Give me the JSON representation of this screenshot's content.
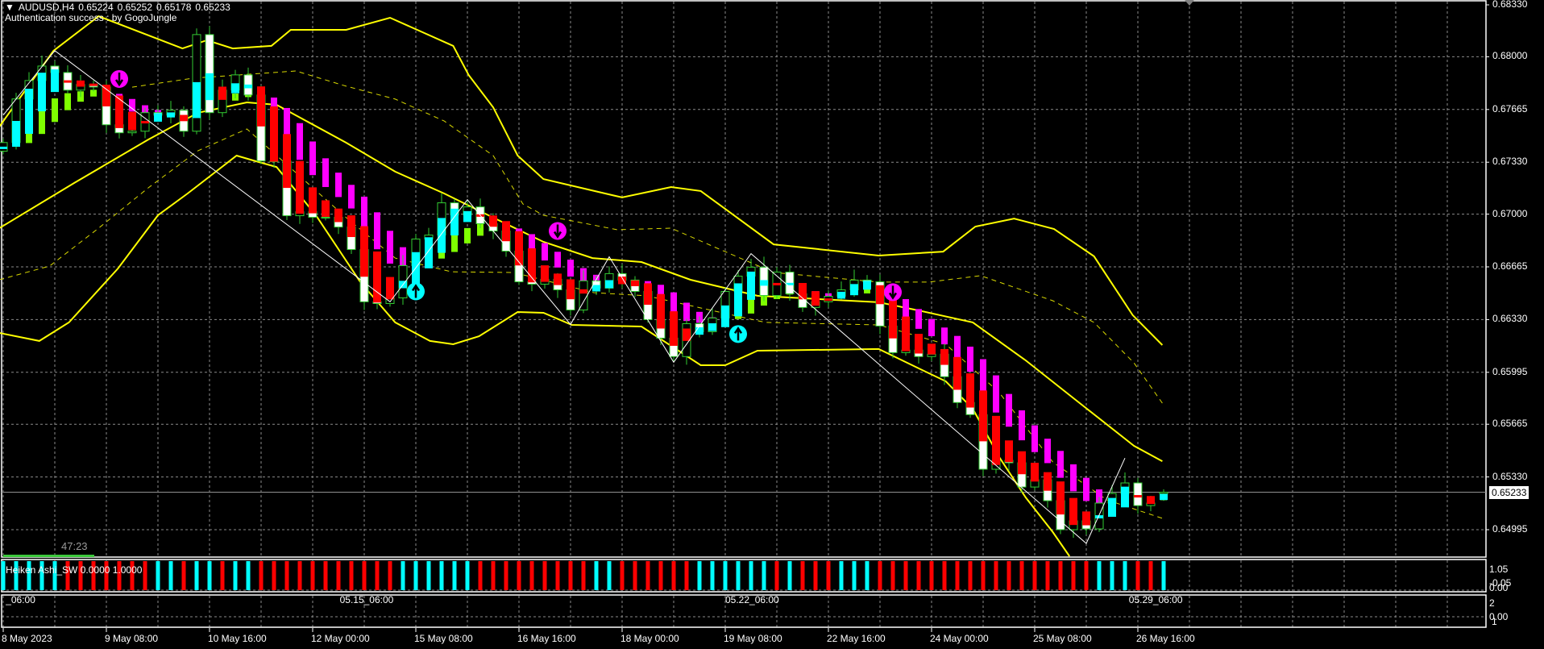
{
  "header": {
    "symbol": "AUDUSD,H4",
    "open": "0.65224",
    "high": "0.65252",
    "low": "0.65178",
    "close": "0.65233"
  },
  "auth_text": "Authentication success : by GogoJungle",
  "countdown": "47:23",
  "indicator_label": "Heiken Ashi_SW 0.0000 1.0000",
  "current_price": "0.65233",
  "price_axis": [
    "0.68330",
    "0.68000",
    "0.67665",
    "0.67330",
    "0.67000",
    "0.66665",
    "0.66330",
    "0.65995",
    "0.65665",
    "0.65330",
    "0.64995"
  ],
  "sub1_axis": [
    "1.05",
    "-0.05",
    "0.00"
  ],
  "sub2_axis": [
    "2",
    "0.00",
    "1"
  ],
  "sub2_time_labels": [
    {
      "text": "_06:00",
      "bar": 0.2
    },
    {
      "text": "05.15_06:00",
      "bar": 26.1
    },
    {
      "text": "05.22_06:00",
      "bar": 56
    },
    {
      "text": "05.29_06:00",
      "bar": 87.3
    }
  ],
  "time_axis": [
    {
      "text": "8 May 2023",
      "bar": 0
    },
    {
      "text": "9 May 08:00",
      "bar": 8
    },
    {
      "text": "10 May 16:00",
      "bar": 16
    },
    {
      "text": "12 May 00:00",
      "bar": 24
    },
    {
      "text": "15 May 08:00",
      "bar": 32
    },
    {
      "text": "16 May 16:00",
      "bar": 40
    },
    {
      "text": "18 May 00:00",
      "bar": 48
    },
    {
      "text": "19 May 08:00",
      "bar": 56
    },
    {
      "text": "22 May 16:00",
      "bar": 64
    },
    {
      "text": "24 May 00:00",
      "bar": 72
    },
    {
      "text": "25 May 08:00",
      "bar": 80
    },
    {
      "text": "26 May 16:00",
      "bar": 88
    }
  ],
  "colors": {
    "up": "#00ffff",
    "down": "#ff0000",
    "smooth_down": "#ff00ff",
    "smooth_up": "#7fff00",
    "band": "#ffff00",
    "candle_outline": "#32cd32",
    "grid": "#8a8a8a",
    "countdown_bar": "#3cc83c"
  },
  "chart_data": {
    "type": "candlestick",
    "symbol": "AUDUSD",
    "timeframe": "H4",
    "ylim": [
      0.649,
      0.6833
    ],
    "first_open": 0.674,
    "closes": [
      0.67455,
      0.67732,
      0.67849,
      0.67941,
      0.679,
      0.67788,
      0.67824,
      0.67808,
      0.67568,
      0.67517,
      0.67527,
      0.67645,
      0.67629,
      0.6766,
      0.67527,
      0.68141,
      0.67645,
      0.67788,
      0.67885,
      0.67757,
      0.67338,
      0.67338,
      0.6699,
      0.67015,
      0.6698,
      0.6698,
      0.66918,
      0.66775,
      0.66443,
      0.66432,
      0.66468,
      0.66673,
      0.66842,
      0.66867,
      0.67072,
      0.66995,
      0.67046,
      0.66939,
      0.66893,
      0.66765,
      0.6657,
      0.66555,
      0.66586,
      0.66519,
      0.66391,
      0.66576,
      0.6653,
      0.66622,
      0.66581,
      0.66509,
      0.6633,
      0.66212,
      0.66095,
      0.66304,
      0.66253,
      0.6634,
      0.66509,
      0.66606,
      0.66663,
      0.66483,
      0.66632,
      0.66494,
      0.66407,
      0.66443,
      0.66478,
      0.66519,
      0.66581,
      0.6657,
      0.66289,
      0.6612,
      0.66136,
      0.66095,
      0.6611,
      0.65967,
      0.65803,
      0.65726,
      0.65379,
      0.65435,
      0.6542,
      0.65266,
      0.65312,
      0.65179,
      0.64995,
      0.65051,
      0.65,
      0.65164,
      0.65225,
      0.65292,
      0.65148,
      0.65164,
      0.65233
    ],
    "heiken_ashi_sw": [
      "up",
      "up",
      "up",
      "up",
      "up",
      "down",
      "down",
      "down",
      "down",
      "down",
      "down",
      "down",
      "up",
      "up",
      "down",
      "up",
      "up",
      "down",
      "up",
      "up",
      "down",
      "down",
      "down",
      "down",
      "down",
      "down",
      "down",
      "down",
      "down",
      "down",
      "down",
      "up",
      "up",
      "up",
      "up",
      "up",
      "up",
      "down",
      "down",
      "down",
      "down",
      "down",
      "down",
      "down",
      "down",
      "down",
      "up",
      "up",
      "down",
      "down",
      "down",
      "down",
      "down",
      "down",
      "up",
      "up",
      "up",
      "up",
      "up",
      "up",
      "down",
      "up",
      "down",
      "down",
      "down",
      "up",
      "up",
      "up",
      "down",
      "down",
      "down",
      "down",
      "down",
      "down",
      "down",
      "down",
      "down",
      "down",
      "down",
      "down",
      "down",
      "down",
      "down",
      "down",
      "down",
      "up",
      "up",
      "up",
      "down",
      "down",
      "up"
    ],
    "signals": [
      {
        "bar": 9,
        "price": 0.67859,
        "dir": "sell"
      },
      {
        "bar": 32,
        "price": 0.66509,
        "dir": "buy"
      },
      {
        "bar": 43,
        "price": 0.66893,
        "dir": "sell"
      },
      {
        "bar": 57,
        "price": 0.66238,
        "dir": "buy"
      },
      {
        "bar": 69,
        "price": 0.66504,
        "dir": "sell"
      }
    ],
    "zigzag": [
      [
        0,
        0.67629
      ],
      [
        4,
        0.68039
      ],
      [
        30,
        0.66443
      ],
      [
        36,
        0.67092
      ],
      [
        44,
        0.66299
      ],
      [
        47,
        0.66729
      ],
      [
        52,
        0.66059
      ],
      [
        58,
        0.66749
      ],
      [
        84,
        0.64908
      ],
      [
        87,
        0.6545
      ]
    ],
    "bands": {
      "upper": [
        [
          -0.3,
          0.67556
        ],
        [
          3.9,
          0.68038
        ],
        [
          7.4,
          0.68258
        ],
        [
          13.9,
          0.68053
        ],
        [
          15.8,
          0.68105
        ],
        [
          17.8,
          0.68053
        ],
        [
          20.8,
          0.68069
        ],
        [
          22.3,
          0.68171
        ],
        [
          26.6,
          0.68171
        ],
        [
          30,
          0.68248
        ],
        [
          34.9,
          0.68069
        ],
        [
          36.1,
          0.67884
        ],
        [
          38,
          0.67679
        ],
        [
          39.9,
          0.67372
        ],
        [
          41.9,
          0.67223
        ],
        [
          48,
          0.67106
        ],
        [
          51.8,
          0.67172
        ],
        [
          54.1,
          0.67147
        ],
        [
          59.75,
          0.66808
        ],
        [
          67.9,
          0.66737
        ],
        [
          72.9,
          0.66762
        ],
        [
          75.4,
          0.66921
        ],
        [
          78.4,
          0.66972
        ],
        [
          81.5,
          0.66906
        ],
        [
          84.6,
          0.66732
        ],
        [
          87.6,
          0.66358
        ],
        [
          89.9,
          0.66168
        ]
      ],
      "middle": [
        [
          -0.3,
          0.66911
        ],
        [
          5.5,
          0.67198
        ],
        [
          11.25,
          0.67474
        ],
        [
          15.1,
          0.67644
        ],
        [
          18.9,
          0.6771
        ],
        [
          21.2,
          0.67695
        ],
        [
          26.6,
          0.67454
        ],
        [
          30.4,
          0.6727
        ],
        [
          34.2,
          0.67131
        ],
        [
          38,
          0.66978
        ],
        [
          41.9,
          0.66824
        ],
        [
          45.7,
          0.66721
        ],
        [
          49.5,
          0.66696
        ],
        [
          53.3,
          0.66583
        ],
        [
          58.5,
          0.66481
        ],
        [
          67.9,
          0.6644
        ],
        [
          71,
          0.66388
        ],
        [
          75.2,
          0.66312
        ],
        [
          79.3,
          0.66071
        ],
        [
          83.5,
          0.65799
        ],
        [
          87.7,
          0.65528
        ],
        [
          89.9,
          0.6543
        ]
      ],
      "lower": [
        [
          -0.3,
          0.66245
        ],
        [
          2.8,
          0.66194
        ],
        [
          5.1,
          0.66312
        ],
        [
          8.9,
          0.66655
        ],
        [
          12,
          0.66993
        ],
        [
          14.3,
          0.67131
        ],
        [
          18.1,
          0.67372
        ],
        [
          19.6,
          0.67336
        ],
        [
          21.2,
          0.673
        ],
        [
          24.25,
          0.66993
        ],
        [
          27.7,
          0.66568
        ],
        [
          30.4,
          0.66312
        ],
        [
          33.1,
          0.66194
        ],
        [
          34.9,
          0.66173
        ],
        [
          36.9,
          0.66224
        ],
        [
          39.9,
          0.66378
        ],
        [
          41.9,
          0.66373
        ],
        [
          44.1,
          0.66296
        ],
        [
          49.5,
          0.66286
        ],
        [
          54.1,
          0.6604
        ],
        [
          56,
          0.6604
        ],
        [
          58.5,
          0.66132
        ],
        [
          67.9,
          0.66143
        ],
        [
          71,
          0.6602
        ],
        [
          73.1,
          0.65938
        ],
        [
          75.2,
          0.65763
        ],
        [
          77.25,
          0.65456
        ],
        [
          79.3,
          0.652
        ],
        [
          81.4,
          0.6498
        ],
        [
          82.7,
          0.64826
        ]
      ],
      "dashed_upper": [
        [
          10,
          0.67807
        ],
        [
          14.7,
          0.67864
        ],
        [
          22.7,
          0.6791
        ],
        [
          26.6,
          0.67813
        ],
        [
          30.4,
          0.67731
        ],
        [
          34.2,
          0.67592
        ],
        [
          38,
          0.67372
        ],
        [
          40.3,
          0.67065
        ],
        [
          41.9,
          0.66993
        ],
        [
          47.6,
          0.66901
        ],
        [
          51.8,
          0.66911
        ],
        [
          55.25,
          0.66788
        ],
        [
          59.75,
          0.66629
        ],
        [
          67.9,
          0.66568
        ],
        [
          71.8,
          0.66568
        ],
        [
          75.8,
          0.66609
        ],
        [
          81.4,
          0.6645
        ],
        [
          84.6,
          0.66312
        ],
        [
          87.7,
          0.66055
        ],
        [
          89.9,
          0.65799
        ]
      ],
      "dashed_lower": [
        [
          -0.3,
          0.66583
        ],
        [
          3.6,
          0.6667
        ],
        [
          7.4,
          0.66911
        ],
        [
          11.25,
          0.67167
        ],
        [
          15.1,
          0.67403
        ],
        [
          18.9,
          0.67541
        ],
        [
          26.6,
          0.66978
        ],
        [
          30.4,
          0.66721
        ],
        [
          34.75,
          0.66634
        ],
        [
          39.6,
          0.66629
        ],
        [
          45.8,
          0.66501
        ],
        [
          49.9,
          0.66481
        ],
        [
          59.1,
          0.66312
        ],
        [
          67.9,
          0.66296
        ],
        [
          73.1,
          0.66173
        ],
        [
          77.25,
          0.65866
        ],
        [
          81.4,
          0.65425
        ],
        [
          85.6,
          0.65184
        ],
        [
          89.9,
          0.65067
        ]
      ]
    }
  }
}
